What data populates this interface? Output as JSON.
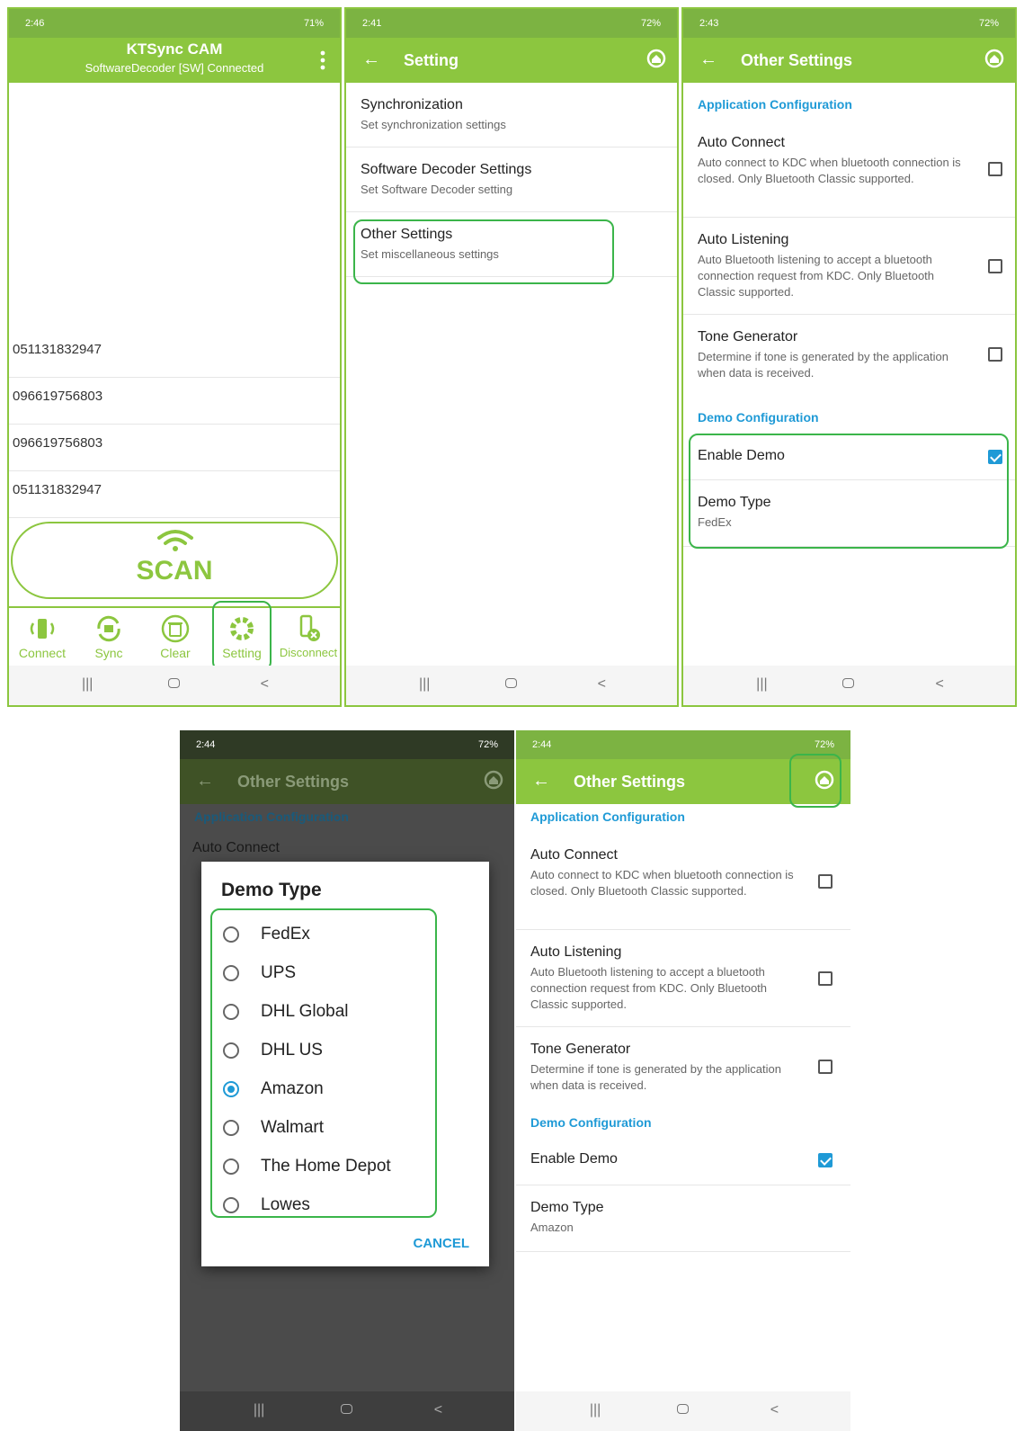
{
  "p1": {
    "status_time": "2:46",
    "status_right": "71%",
    "app_title": "KTSync CAM",
    "app_subtitle": "SoftwareDecoder [SW] Connected",
    "barcodes": [
      "051131832947",
      "096619756803",
      "096619756803",
      "051131832947"
    ],
    "scan_label": "SCAN",
    "tools": [
      "Connect",
      "Sync",
      "Clear",
      "Setting",
      "Disconnect"
    ]
  },
  "p2": {
    "status_time": "2:41",
    "status_right": "72%",
    "title": "Setting",
    "items": [
      {
        "title": "Synchronization",
        "subtitle": "Set synchronization settings"
      },
      {
        "title": "Software Decoder Settings",
        "subtitle": "Set Software Decoder setting"
      },
      {
        "title": "Other Settings",
        "subtitle": "Set miscellaneous settings"
      }
    ]
  },
  "p3": {
    "status_time": "2:43",
    "status_right": "72%",
    "title": "Other Settings",
    "app_config": "Application Configuration",
    "auto_connect": {
      "title": "Auto Connect",
      "desc": "Auto connect to KDC when bluetooth connection is closed. Only Bluetooth Classic supported."
    },
    "auto_listening": {
      "title": "Auto Listening",
      "desc": "Auto Bluetooth listening to accept a bluetooth connection request from KDC. Only Bluetooth Classic supported."
    },
    "tone_generator": {
      "title": "Tone Generator",
      "desc": "Determine if tone is generated by the application when data is received."
    },
    "demo_config": "Demo Configuration",
    "enable_demo": "Enable Demo",
    "demo_type": {
      "title": "Demo Type",
      "value": "FedEx"
    }
  },
  "p4": {
    "status_time": "2:44",
    "status_right": "72%",
    "title": "Other Settings",
    "app_config": "Application Configuration",
    "auto_connect": "Auto Connect",
    "dialog_title": "Demo Type",
    "options": [
      "FedEx",
      "UPS",
      "DHL Global",
      "DHL US",
      "Amazon",
      "Walmart",
      "The Home Depot",
      "Lowes"
    ],
    "selected": "Amazon",
    "cancel": "CANCEL"
  },
  "p5": {
    "status_time": "2:44",
    "status_right": "72%",
    "title": "Other Settings",
    "app_config": "Application Configuration",
    "auto_connect": {
      "title": "Auto Connect",
      "desc": "Auto connect to KDC when bluetooth connection is closed. Only Bluetooth Classic supported."
    },
    "auto_listening": {
      "title": "Auto Listening",
      "desc": "Auto Bluetooth listening to accept a bluetooth connection request from KDC. Only Bluetooth Classic supported."
    },
    "tone_generator": {
      "title": "Tone Generator",
      "desc": "Determine if tone is generated by the application when data is received."
    },
    "demo_config": "Demo Configuration",
    "enable_demo": "Enable Demo",
    "demo_type": {
      "title": "Demo Type",
      "value": "Amazon"
    }
  },
  "colors": {
    "primary": "#8cc63f",
    "status": "#7cb342",
    "accent": "#1f9ad6",
    "highlight": "#3bb54a"
  },
  "icons": [
    "back-arrow-icon",
    "home-icon",
    "kebab-menu-icon",
    "wifi-icon",
    "connect-icon",
    "sync-icon",
    "trash-icon",
    "gear-icon",
    "disconnect-icon"
  ]
}
